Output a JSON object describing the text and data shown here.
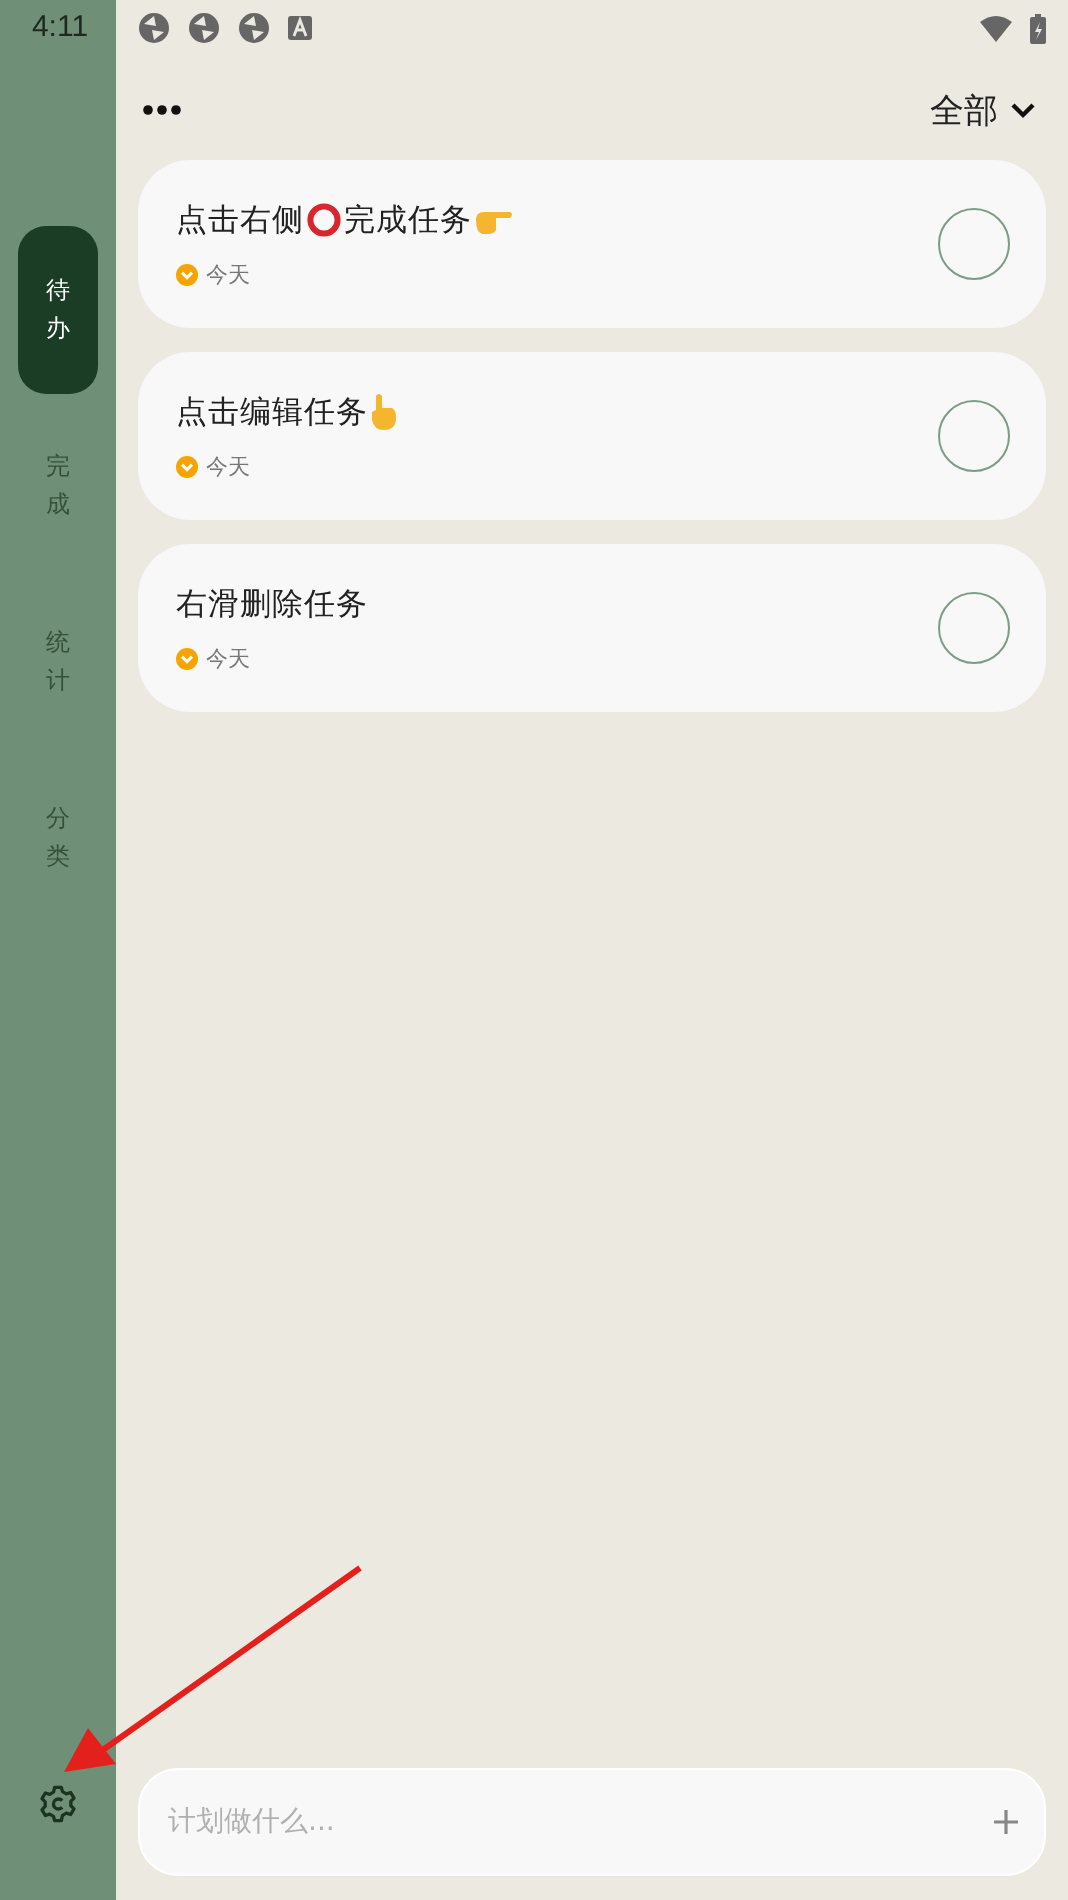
{
  "status_bar": {
    "time": "4:11"
  },
  "sidebar": {
    "items": [
      {
        "label": "待办",
        "selected": true
      },
      {
        "label": "完成",
        "selected": false
      },
      {
        "label": "统计",
        "selected": false
      },
      {
        "label": "分类",
        "selected": false
      }
    ]
  },
  "header": {
    "filter": "全部"
  },
  "tasks": [
    {
      "title": [
        {
          "kind": "text",
          "text": "点击右侧"
        },
        {
          "kind": "ring"
        },
        {
          "kind": "text",
          "text": "完成任务"
        },
        {
          "kind": "point-right"
        }
      ],
      "due": "今天",
      "checked": false
    },
    {
      "title": [
        {
          "kind": "text",
          "text": "点击编辑任务"
        },
        {
          "kind": "point-up"
        }
      ],
      "due": "今天",
      "checked": false
    },
    {
      "title": [
        {
          "kind": "text",
          "text": "右滑删除任务"
        }
      ],
      "due": "今天",
      "checked": false
    }
  ],
  "input": {
    "placeholder": "计划做什么..."
  }
}
